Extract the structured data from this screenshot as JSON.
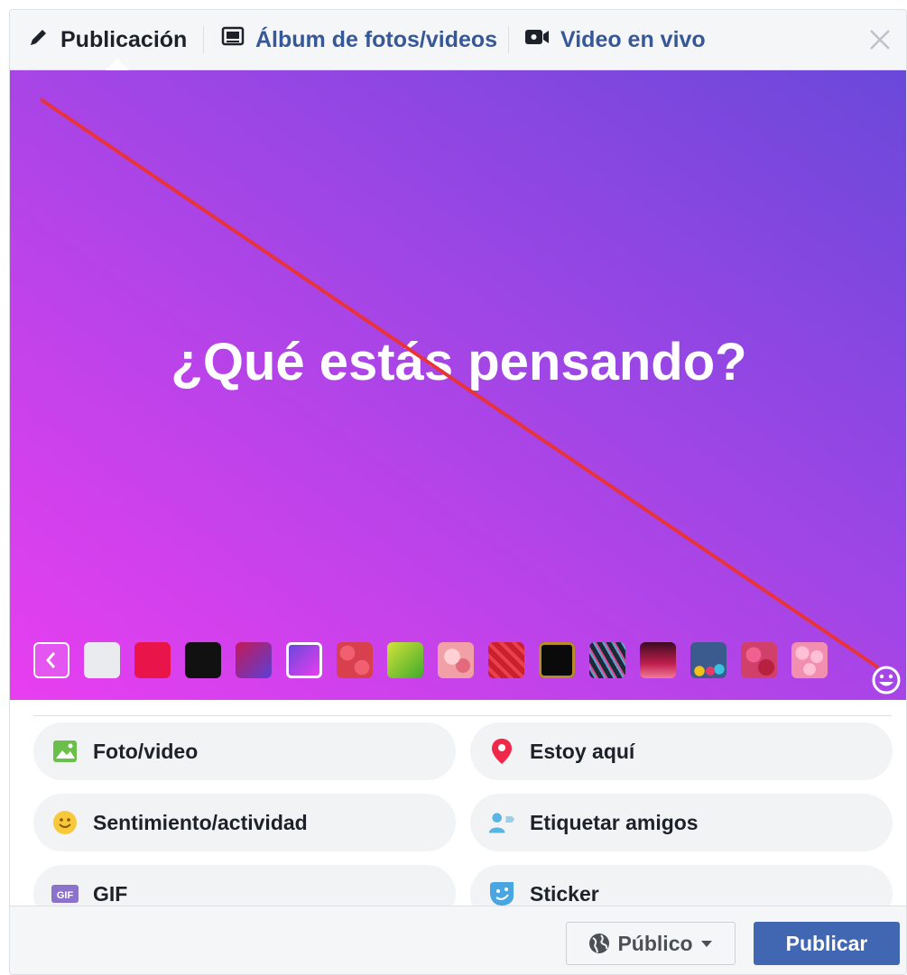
{
  "tabs": {
    "post": "Publicación",
    "album": "Álbum de fotos/videos",
    "live": "Video en vivo"
  },
  "composer": {
    "placeholder": "¿Qué estás pensando?",
    "gradient_colors": [
      "#e83ef0",
      "#6a48d9"
    ]
  },
  "backgrounds": [
    {
      "name": "light-gray",
      "color": "#e9ebee"
    },
    {
      "name": "red",
      "color": "#e8144a"
    },
    {
      "name": "black",
      "color": "#111111"
    },
    {
      "name": "purple-red-gradient",
      "color": "#7a3fb8"
    },
    {
      "name": "purple-gradient-selected",
      "color": "#b44ae8"
    },
    {
      "name": "hearts-pattern",
      "color": "#d9404e"
    },
    {
      "name": "green-gradient",
      "color": "#7cc02a"
    },
    {
      "name": "pink-pattern",
      "color": "#f2a0a8"
    },
    {
      "name": "red-floral",
      "color": "#cc1f2e"
    },
    {
      "name": "black-gold-frame",
      "color": "#0a0a0a"
    },
    {
      "name": "dark-swirl",
      "color": "#24333f"
    },
    {
      "name": "dark-pink-gradient",
      "color": "#c01f4e"
    },
    {
      "name": "blue-hearts",
      "color": "#3b5b8e"
    },
    {
      "name": "red-hearts-pattern",
      "color": "#d1406a"
    },
    {
      "name": "pink-bubbles",
      "color": "#f28fb0"
    }
  ],
  "actions": [
    {
      "label": "Foto/video",
      "icon": "photo-icon"
    },
    {
      "label": "Estoy aquí",
      "icon": "location-pin-icon"
    },
    {
      "label": "Sentimiento/actividad",
      "icon": "smiley-icon"
    },
    {
      "label": "Etiquetar amigos",
      "icon": "tag-friends-icon"
    },
    {
      "label": "GIF",
      "icon": "gif-icon"
    },
    {
      "label": "Sticker",
      "icon": "sticker-icon"
    }
  ],
  "footer": {
    "audience": "Público",
    "publish": "Publicar"
  },
  "colors": {
    "link_blue": "#365899",
    "publish_blue": "#4267b2",
    "annotation_line": "#e8333a"
  }
}
